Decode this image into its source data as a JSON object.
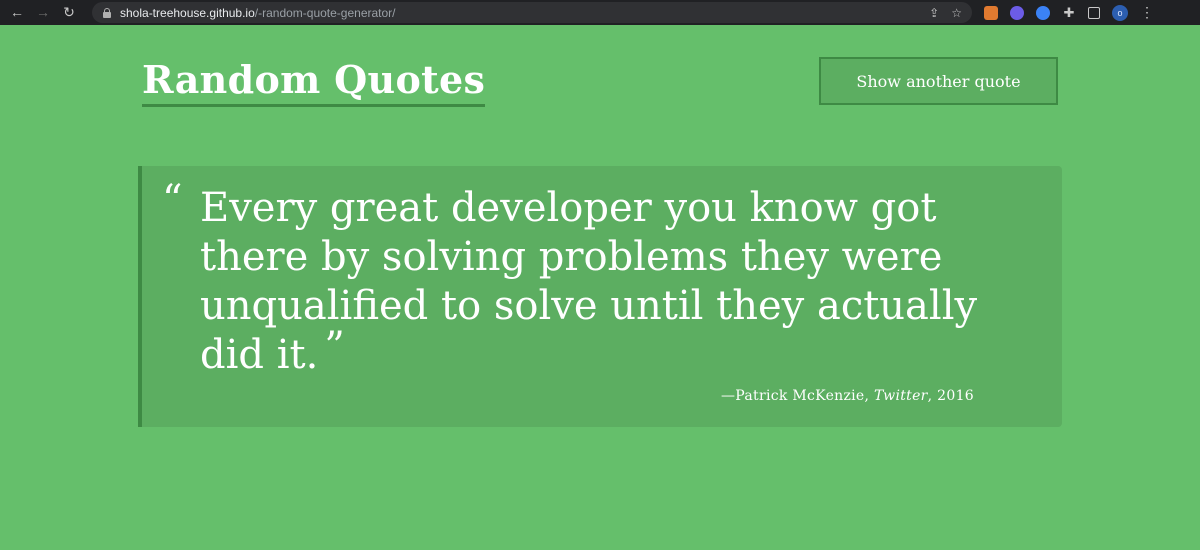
{
  "browser": {
    "url_host": "shola-treehouse.github.io",
    "url_path": "/-random-quote-generator/",
    "icons": [
      "back-icon",
      "forward-icon",
      "reload-icon",
      "lock-icon",
      "share-icon",
      "star-icon",
      "metamask-icon",
      "extension-icon",
      "extension-icon",
      "puzzle-icon",
      "side-panel-icon",
      "profile-avatar",
      "menu-icon"
    ],
    "avatar_letter": "o"
  },
  "page": {
    "title": "Random Quotes",
    "button_label": "Show another quote",
    "quote": {
      "open_mark": "“",
      "text": "Every great developer you know got there by solving problems they were unqualified to solve until they actually did it.",
      "close_mark": "”",
      "author": "—Patrick McKenzie, ",
      "source": "Twitter",
      "year": ", 2016"
    }
  },
  "colors": {
    "background": "#65bf6b",
    "box": "#5cae61",
    "accent": "#3e8a44",
    "text": "#ffffff"
  }
}
